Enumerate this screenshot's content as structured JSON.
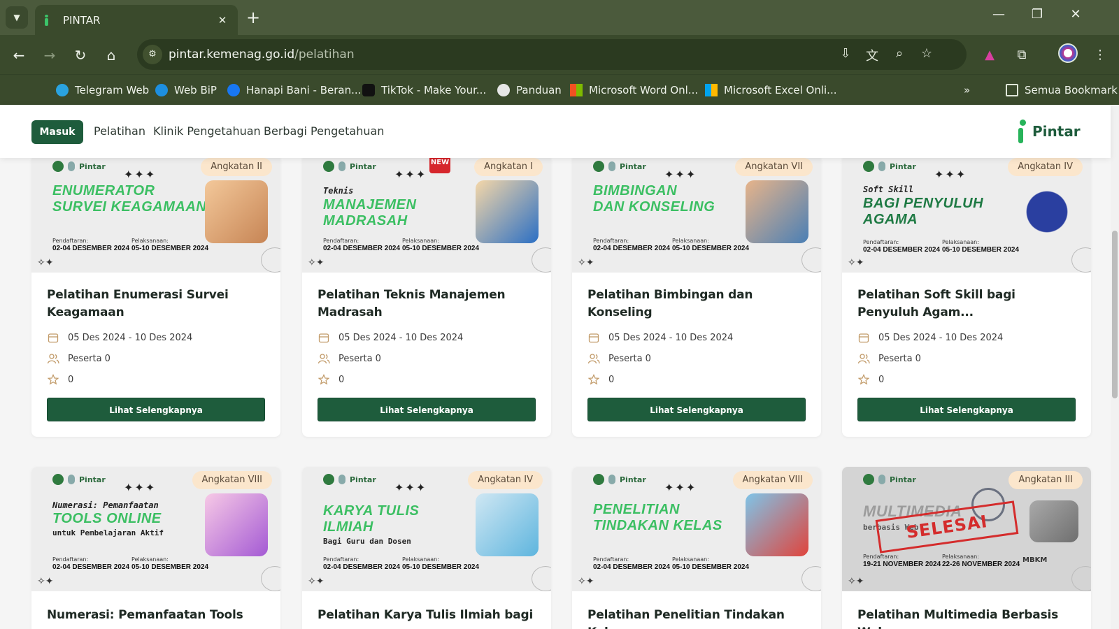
{
  "browser": {
    "tab_title": "PINTAR",
    "url_host": "pintar.kemenag.go.id",
    "url_path": "/pelatihan",
    "bookmarks": [
      {
        "label": "Telegram Web",
        "color": "#2aa3e0"
      },
      {
        "label": "Web BiP",
        "color": "#1d8fe0"
      },
      {
        "label": "Hanapi Bani - Beran...",
        "color": "#1877f2"
      },
      {
        "label": "TikTok - Make Your...",
        "color": "#111111"
      },
      {
        "label": "Panduan",
        "color": "#e6e6e6"
      },
      {
        "label": "Microsoft Word Onl...",
        "color": "#f25022"
      },
      {
        "label": "Microsoft Excel Onli...",
        "color": "#f25022"
      }
    ],
    "all_bookmarks": "Semua Bookmark"
  },
  "header": {
    "login": "Masuk",
    "nav": [
      "Pelatihan",
      "Klinik Pengetahuan",
      "Berbagi Pengetahuan"
    ],
    "brand": "Pintar"
  },
  "colors": {
    "primary": "#1e5c3c",
    "accent_green": "#3cbf63",
    "badge_bg": "#fbe6cc"
  },
  "cards": [
    {
      "badge": "Angkatan II",
      "banner_pre": "",
      "banner_title": [
        "ENUMERATOR",
        "SURVEI KEAGAMAAN"
      ],
      "banner_post": "",
      "reg_label": "Pendaftaran:",
      "reg_date": "02-04 DESEMBER 2024",
      "exec_label": "Pelaksanaan:",
      "exec_date": "05-10 DESEMBER 2024",
      "title": "Pelatihan Enumerasi Survei Keagamaan",
      "dates": "05 Des 2024 - 10 Des 2024",
      "participants": "Peserta 0",
      "rating": "0",
      "button": "Lihat Selengkapnya"
    },
    {
      "badge": "Angkatan I",
      "new": "NEW",
      "banner_pre": "Teknis",
      "banner_title": [
        "MANAJEMEN",
        "MADRASAH"
      ],
      "banner_post": "",
      "reg_label": "Pendaftaran:",
      "reg_date": "02-04 DESEMBER 2024",
      "exec_label": "Pelaksanaan:",
      "exec_date": "05-10 DESEMBER 2024",
      "title": "Pelatihan Teknis Manajemen Madrasah",
      "dates": "05 Des 2024 - 10 Des 2024",
      "participants": "Peserta 0",
      "rating": "0",
      "button": "Lihat Selengkapnya"
    },
    {
      "badge": "Angkatan VII",
      "banner_pre": "",
      "banner_title": [
        "BIMBINGAN",
        "DAN KONSELING"
      ],
      "banner_post": "",
      "reg_label": "Pendaftaran:",
      "reg_date": "02-04 DESEMBER 2024",
      "exec_label": "Pelaksanaan:",
      "exec_date": "05-10 DESEMBER 2024",
      "title": "Pelatihan Bimbingan dan Konseling",
      "dates": "05 Des 2024 - 10 Des 2024",
      "participants": "Peserta 0",
      "rating": "0",
      "button": "Lihat Selengkapnya"
    },
    {
      "badge": "Angkatan IV",
      "banner_pre": "Soft Skill",
      "banner_title": [
        "BAGI PENYULUH",
        "AGAMA"
      ],
      "banner_post": "",
      "reg_label": "Pendaftaran:",
      "reg_date": "02-04 DESEMBER 2024",
      "exec_label": "Pelaksanaan:",
      "exec_date": "05-10 DESEMBER 2024",
      "title": "Pelatihan Soft Skill bagi Penyuluh Agam...",
      "dates": "05 Des 2024 - 10 Des 2024",
      "participants": "Peserta 0",
      "rating": "0",
      "button": "Lihat Selengkapnya"
    },
    {
      "badge": "Angkatan VIII",
      "banner_pre": "Numerasi: Pemanfaatan",
      "banner_title": [
        "TOOLS ONLINE"
      ],
      "banner_post": "untuk Pembelajaran Aktif",
      "reg_label": "Pendaftaran:",
      "reg_date": "02-04 DESEMBER 2024",
      "exec_label": "Pelaksanaan:",
      "exec_date": "05-10 DESEMBER 2024",
      "title": "Numerasi: Pemanfaatan Tools"
    },
    {
      "badge": "Angkatan IV",
      "banner_pre": "",
      "banner_title": [
        "KARYA TULIS",
        "ILMIAH"
      ],
      "banner_post": "Bagi Guru dan Dosen",
      "reg_label": "Pendaftaran:",
      "reg_date": "02-04 DESEMBER 2024",
      "exec_label": "Pelaksanaan:",
      "exec_date": "05-10 DESEMBER 2024",
      "title": "Pelatihan Karya Tulis Ilmiah bagi"
    },
    {
      "badge": "Angkatan VIII",
      "banner_pre": "",
      "banner_title": [
        "PENELITIAN",
        "TINDAKAN KELAS"
      ],
      "banner_post": "",
      "reg_label": "Pendaftaran:",
      "reg_date": "02-04 DESEMBER 2024",
      "exec_label": "Pelaksanaan:",
      "exec_date": "05-10 DESEMBER 2024",
      "title": "Pelatihan Penelitian Tindakan Kelas"
    },
    {
      "badge": "Angkatan III",
      "banner_pre": "",
      "banner_title": [
        "MULTIMEDIA"
      ],
      "banner_post": "berbasis Web",
      "reg_label": "Pendaftaran:",
      "reg_date": "19-21 NOVEMBER 2024",
      "exec_label": "Pelaksanaan:",
      "exec_date": "22-26 NOVEMBER 2024",
      "stamp": "SELESAI",
      "mbkm": "MBKM",
      "title": "Pelatihan Multimedia Berbasis Web"
    }
  ]
}
